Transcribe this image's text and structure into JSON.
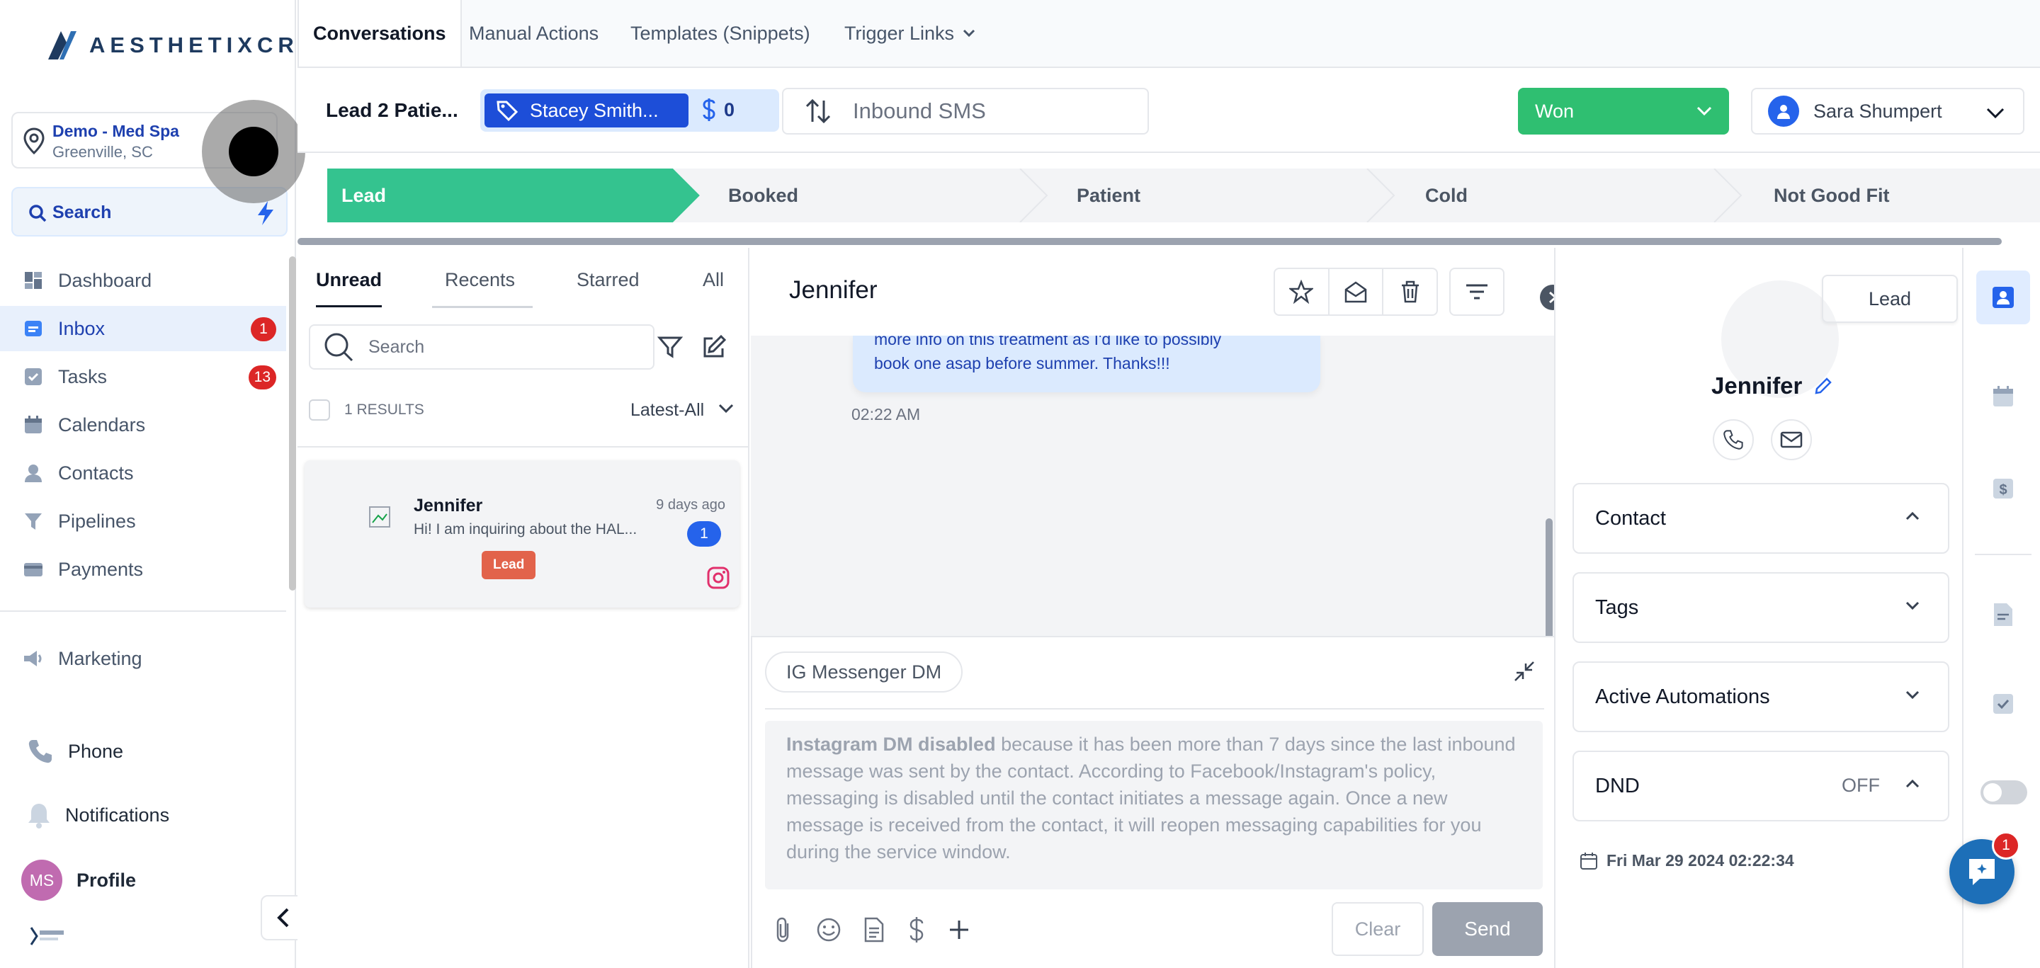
{
  "app": {
    "logo_text": "AESTHETIXCRM"
  },
  "location": {
    "name": "Demo - Med Spa",
    "city": "Greenville, SC"
  },
  "search": {
    "label": "Search"
  },
  "nav": [
    {
      "label": "Dashboard",
      "icon": "dashboard-icon"
    },
    {
      "label": "Inbox",
      "icon": "inbox-icon",
      "badge": "1"
    },
    {
      "label": "Tasks",
      "icon": "tasks-icon",
      "badge": "13"
    },
    {
      "label": "Calendars",
      "icon": "calendar-icon"
    },
    {
      "label": "Contacts",
      "icon": "contacts-icon"
    },
    {
      "label": "Pipelines",
      "icon": "pipelines-icon"
    },
    {
      "label": "Payments",
      "icon": "payments-icon"
    }
  ],
  "nav_secondary": {
    "marketing": "Marketing"
  },
  "sidebar_bottom": {
    "phone": "Phone",
    "notifications": "Notifications",
    "profile": "Profile",
    "profile_initials": "MS"
  },
  "top_tabs": [
    "Conversations",
    "Manual Actions",
    "Templates (Snippets)",
    "Trigger Links"
  ],
  "deal": {
    "lead_label": "Lead 2 Patie...",
    "tag_name": "Stacey Smith...",
    "amount": "0",
    "inbound": "Inbound SMS",
    "status": "Won",
    "owner": "Sara Shumpert"
  },
  "stages": [
    "Lead",
    "Booked",
    "Patient",
    "Cold",
    "Not Good Fit"
  ],
  "list": {
    "tabs": [
      "Unread",
      "Recents",
      "Starred",
      "All"
    ],
    "search_placeholder": "Search",
    "results": "1 RESULTS",
    "sort": "Latest-All",
    "items": [
      {
        "name": "Jennifer",
        "preview": "Hi! I am inquiring about the HAL...",
        "time": "9 days ago",
        "count": "1",
        "tag": "Lead"
      }
    ]
  },
  "conversation": {
    "title": "Jennifer",
    "bubble_lines": [
      "more info on this treatment as I'd like to possibly",
      "book one asap before summer. Thanks!!!"
    ],
    "bubble_time": "02:22 AM",
    "channel": "IG Messenger DM",
    "disabled_bold": "Instagram DM disabled",
    "disabled_rest": " because it has been more than 7 days since the last inbound message was sent by the contact. According to Facebook/Instagram's policy, messaging is disabled until the contact initiates a message again. Once a new message is received from the contact, it will reopen messaging capabilities for you during the service window.",
    "clear": "Clear",
    "send": "Send"
  },
  "contact": {
    "stage_button": "Lead",
    "name": "Jennifer",
    "sections": [
      "Contact",
      "Tags",
      "Active Automations",
      "DND"
    ],
    "dnd_value": "OFF",
    "created": "Fri Mar 29 2024 02:22:34"
  },
  "chat_widget": {
    "badge": "1"
  },
  "colors": {
    "accent": "#1d4ed8",
    "won": "#2fbf71",
    "stage_active": "#34c38f",
    "danger": "#dc2626"
  }
}
